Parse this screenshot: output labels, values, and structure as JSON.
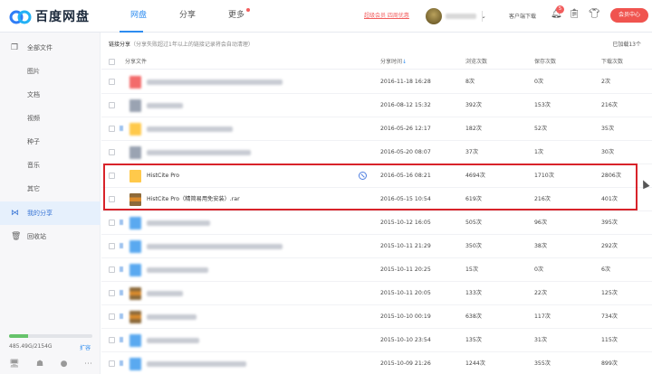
{
  "header": {
    "logo_text": "百度网盘",
    "nav": [
      {
        "label": "网盘",
        "active": true
      },
      {
        "label": "分享",
        "active": false
      },
      {
        "label": "更多",
        "active": false,
        "dot": true
      }
    ],
    "promo_text": "超级会员 四周优惠",
    "client_download": "客户端下载",
    "notification_count": "5",
    "vip_button": "会员中心"
  },
  "sidebar": {
    "items": [
      {
        "label": "全部文件",
        "icon": "file-copy-icon"
      },
      {
        "label": "图片"
      },
      {
        "label": "文档"
      },
      {
        "label": "视频"
      },
      {
        "label": "种子"
      },
      {
        "label": "音乐"
      },
      {
        "label": "其它"
      },
      {
        "label": "我的分享",
        "icon": "share-icon",
        "active": true
      },
      {
        "label": "回收站",
        "icon": "trash-icon"
      }
    ],
    "quota_text": "485.49G/2154G",
    "quota_fraction": 0.225,
    "expand_label": "扩容"
  },
  "main": {
    "crumb_title": "链接分享",
    "crumb_note": "（分享失败超过1年以上的链接记录将会自动清理）",
    "loaded": "已加载13个",
    "columns": [
      "分享文件",
      "分享时间",
      "浏览次数",
      "保存次数",
      "下载次数"
    ],
    "sort_arrow": "↓",
    "rows": [
      {
        "time": "2016-11-18 16:28",
        "views": "8次",
        "saves": "0次",
        "downloads": "2次",
        "icon": "red",
        "name_w": 150
      },
      {
        "time": "2016-08-12 15:32",
        "views": "392次",
        "saves": "153次",
        "downloads": "216次",
        "icon": "gray",
        "name_w": 40
      },
      {
        "time": "2016-05-26 12:17",
        "views": "182次",
        "saves": "52次",
        "downloads": "35次",
        "icon": "folder",
        "name_w": 95,
        "arrow": true
      },
      {
        "time": "2016-05-20 08:07",
        "views": "37次",
        "saves": "1次",
        "downloads": "30次",
        "icon": "gray",
        "name_w": 115
      },
      {
        "name": "HistCite Pro",
        "time": "2016-05-16 08:21",
        "views": "4694次",
        "saves": "1710次",
        "downloads": "2806次",
        "icon": "folder",
        "clear": true,
        "cancel": true
      },
      {
        "name": "HistCite Pro（精简易用免安装）.rar",
        "time": "2016-05-15 10:54",
        "views": "619次",
        "saves": "216次",
        "downloads": "401次",
        "icon": "zip",
        "clear": true
      },
      {
        "time": "2015-10-12 16:05",
        "views": "505次",
        "saves": "96次",
        "downloads": "395次",
        "icon": "blue",
        "name_w": 70,
        "arrow": true
      },
      {
        "time": "2015-10-11 21:29",
        "views": "350次",
        "saves": "38次",
        "downloads": "292次",
        "icon": "blue",
        "name_w": 150,
        "arrow": true
      },
      {
        "time": "2015-10-11 20:25",
        "views": "15次",
        "saves": "0次",
        "downloads": "6次",
        "icon": "blue",
        "name_w": 68,
        "arrow": true
      },
      {
        "time": "2015-10-11 20:05",
        "views": "133次",
        "saves": "22次",
        "downloads": "125次",
        "icon": "zip",
        "name_w": 40,
        "arrow": true
      },
      {
        "time": "2015-10-10 00:19",
        "views": "638次",
        "saves": "117次",
        "downloads": "734次",
        "icon": "zip",
        "name_w": 55,
        "arrow": true
      },
      {
        "time": "2015-10-10 23:54",
        "views": "135次",
        "saves": "31次",
        "downloads": "115次",
        "icon": "blue",
        "name_w": 58,
        "arrow": true
      },
      {
        "time": "2015-10-09 21:26",
        "views": "1244次",
        "saves": "355次",
        "downloads": "899次",
        "icon": "blue",
        "name_w": 110,
        "arrow": true
      }
    ]
  },
  "colors": {
    "accent": "#2d8cf0",
    "highlight": "#d8232a",
    "vip": "#f0544f"
  }
}
